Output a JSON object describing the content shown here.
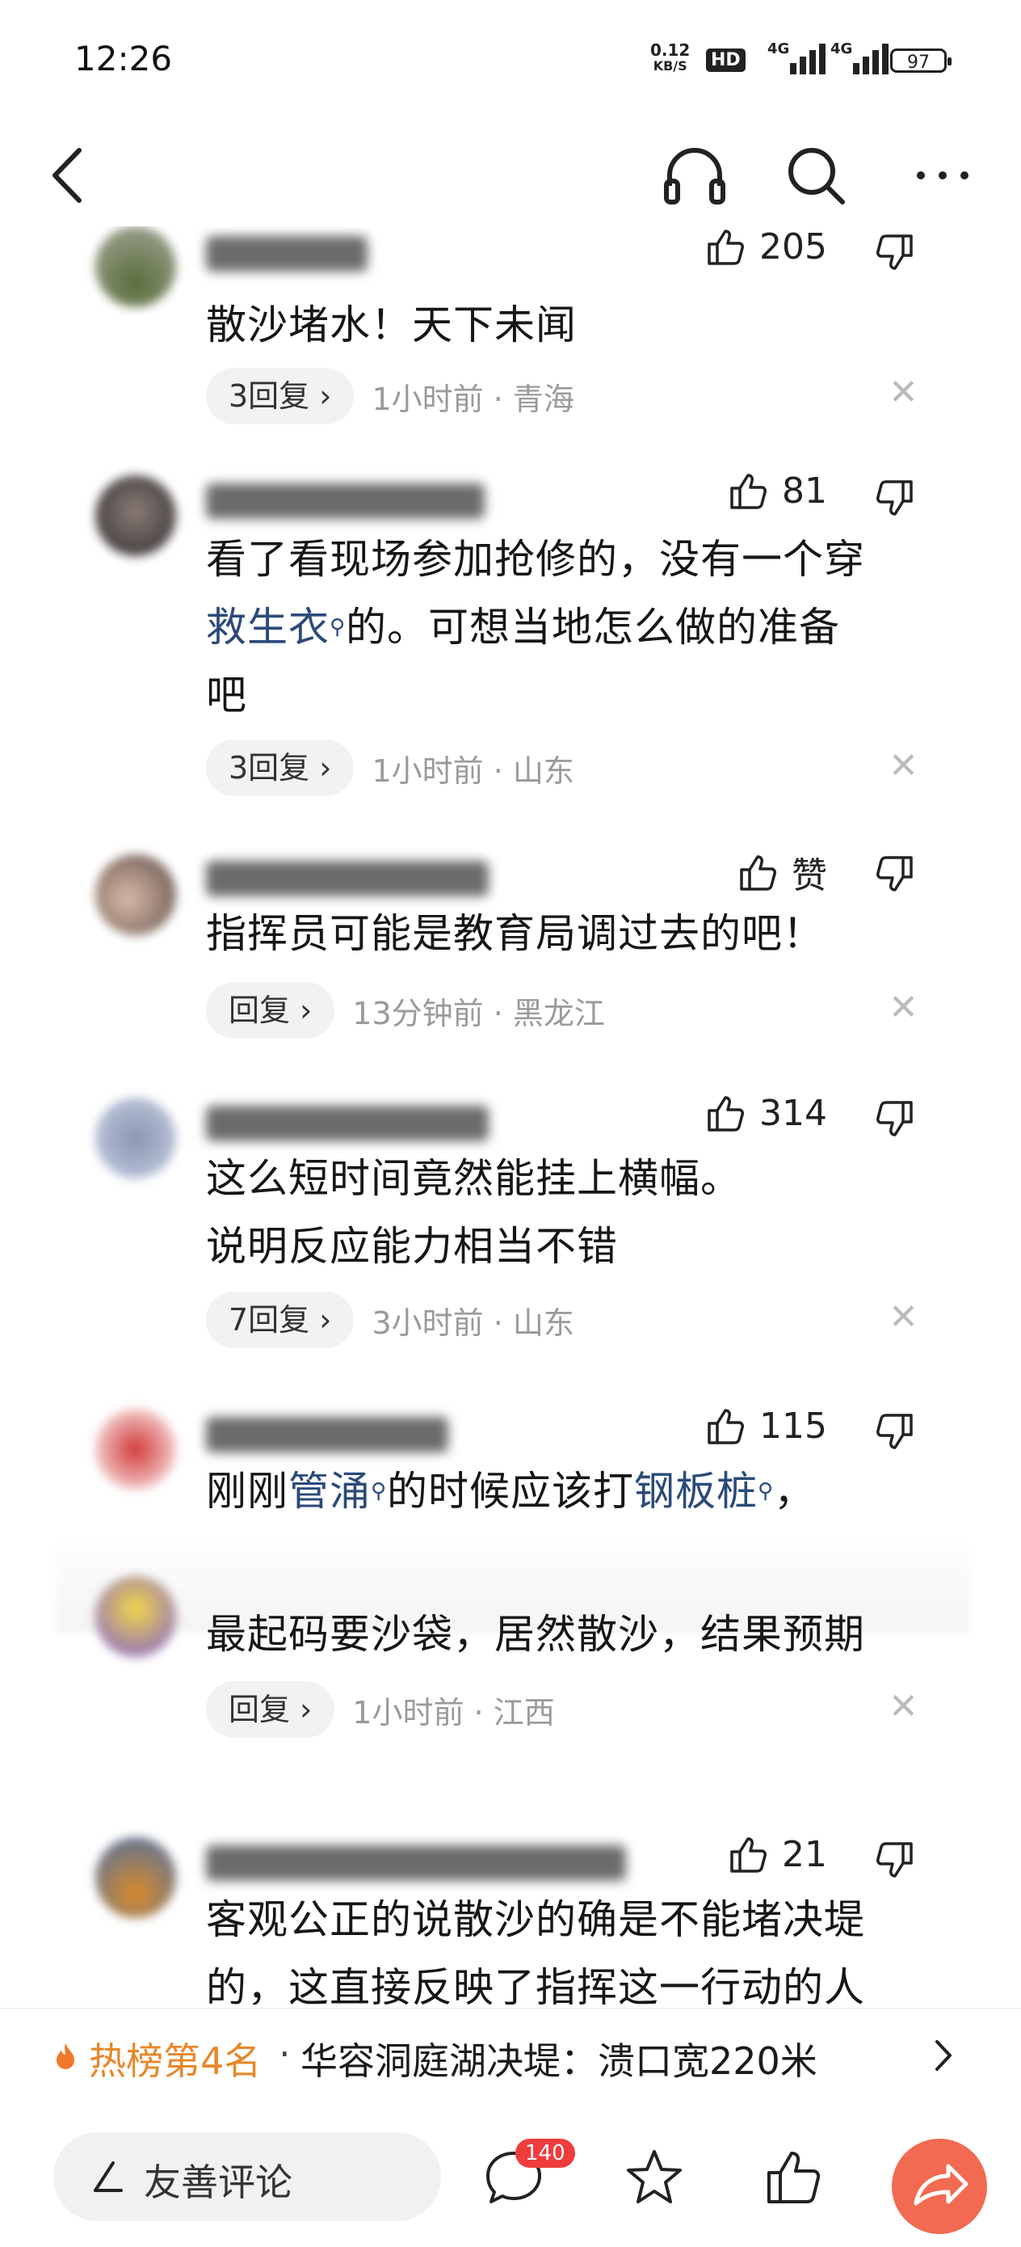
{
  "status_bar": {
    "time": "12:26",
    "net_speed": "0.12",
    "net_unit": "KB/S",
    "hd_label": "HD",
    "signal1_label": "4G",
    "signal2_label": "4G",
    "battery": "97"
  },
  "nav": {
    "back_icon": "chevron-left-icon",
    "listen_icon": "headphones-icon",
    "search_icon": "search-icon",
    "more_icon": "more-icon"
  },
  "comments": [
    {
      "likes": "205",
      "text": "散沙堵水！天下未闻",
      "reply_label": "3回复 ›",
      "meta": "1小时前 · 青海"
    },
    {
      "likes": "81",
      "text_part1": "看了看现场参加抢修的，没有一个穿",
      "link": "救生衣",
      "text_part2": "的。可想当地怎么做的准备",
      "text_part3": "吧",
      "reply_label": "3回复 ›",
      "meta": "1小时前 · 山东"
    },
    {
      "likes": "赞",
      "text": "指挥员可能是教育局调过去的吧！",
      "reply_label": "回复 ›",
      "meta": "13分钟前 · 黑龙江"
    },
    {
      "likes": "314",
      "text_line1": "这么短时间竟然能挂上横幅。",
      "text_line2": "说明反应能力相当不错",
      "reply_label": "7回复 ›",
      "meta": "3小时前 · 山东"
    },
    {
      "likes": "115",
      "text_part1": "刚刚",
      "link1": "管涌",
      "text_part2": "的时候应该打",
      "link2": "钢板桩",
      "text_part3": "，"
    },
    {
      "text": "最起码要沙袋，居然散沙，结果预期",
      "reply_label": "回复 ›",
      "meta": "1小时前 · 江西"
    },
    {
      "likes": "21",
      "text_line1": "客观公正的说散沙的确是不能堵决堤",
      "text_line2": "的，这直接反映了指挥这一行动的人"
    }
  ],
  "hot_bar": {
    "rank": "热榜第4名",
    "separator": "·",
    "headline": "华容洞庭湖决堤：溃口宽220米"
  },
  "bottom_bar": {
    "input_placeholder": "友善评论",
    "comment_count": "140"
  }
}
